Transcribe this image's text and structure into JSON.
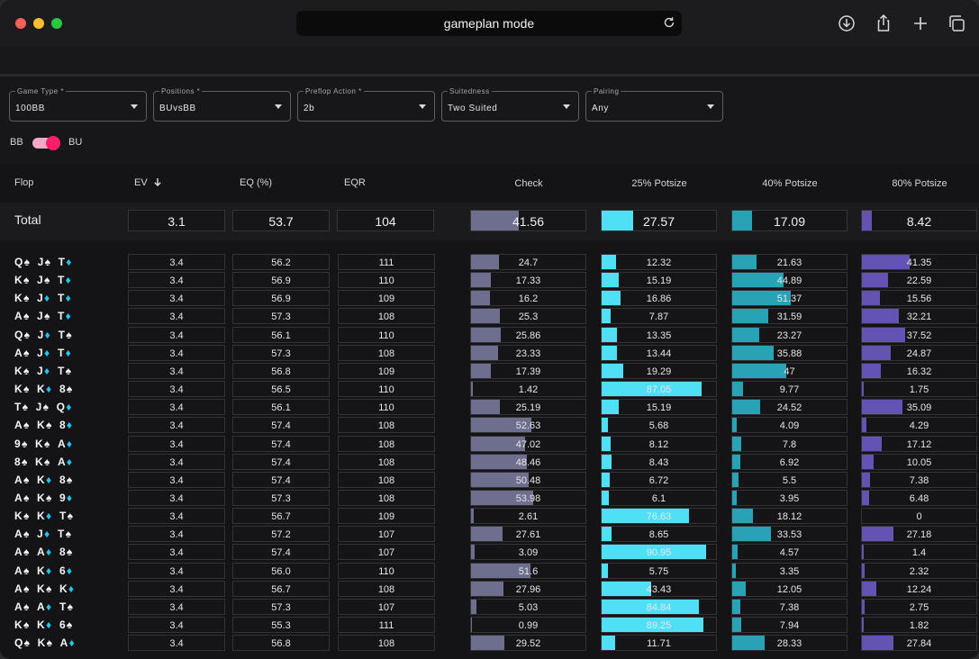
{
  "browser": {
    "address": "gameplan mode"
  },
  "filters": [
    {
      "label": "Game Type *",
      "value": "100BB"
    },
    {
      "label": "Positions *",
      "value": "BUvsBB"
    },
    {
      "label": "Preflop Action *",
      "value": "2b"
    },
    {
      "label": "Suitedness",
      "value": "Two Suited"
    },
    {
      "label": "Pairing",
      "value": "Any"
    }
  ],
  "toggle": {
    "left": "BB",
    "right": "BU",
    "state": "BU"
  },
  "headers": {
    "flop": "Flop",
    "ev": "EV",
    "eq": "EQ (%)",
    "eqr": "EQR",
    "check": "Check",
    "bet25": "25% Potsize",
    "bet40": "40% Potsize",
    "bet80": "80% Potsize"
  },
  "colors": {
    "check": "#6e6e8e",
    "bet25": "#50e0f5",
    "bet40": "#2aa2b6",
    "bet80": "#6553b4",
    "toggle": "#ff1d6c",
    "spade": "#f4f4f6",
    "diamond": "#21c6f2"
  },
  "total": {
    "label": "Total",
    "ev": "3.1",
    "eq": "53.7",
    "eqr": "104",
    "check": "41.56",
    "bet25": "27.57",
    "bet40": "17.09",
    "bet80": "8.42"
  },
  "rows": [
    {
      "cards": [
        [
          "Q",
          "s"
        ],
        [
          "J",
          "s"
        ],
        [
          "T",
          "d"
        ]
      ],
      "ev": "3.4",
      "eq": "56.2",
      "eqr": "111",
      "check": "24.7",
      "bet25": "12.32",
      "bet40": "21.63",
      "bet80": "41.35"
    },
    {
      "cards": [
        [
          "K",
          "s"
        ],
        [
          "J",
          "s"
        ],
        [
          "T",
          "d"
        ]
      ],
      "ev": "3.4",
      "eq": "56.9",
      "eqr": "110",
      "check": "17.33",
      "bet25": "15.19",
      "bet40": "44.89",
      "bet80": "22.59"
    },
    {
      "cards": [
        [
          "K",
          "s"
        ],
        [
          "J",
          "d"
        ],
        [
          "T",
          "d"
        ]
      ],
      "ev": "3.4",
      "eq": "56.9",
      "eqr": "109",
      "check": "16.2",
      "bet25": "16.86",
      "bet40": "51.37",
      "bet80": "15.56"
    },
    {
      "cards": [
        [
          "A",
          "s"
        ],
        [
          "J",
          "s"
        ],
        [
          "T",
          "d"
        ]
      ],
      "ev": "3.4",
      "eq": "57.3",
      "eqr": "108",
      "check": "25.3",
      "bet25": "7.87",
      "bet40": "31.59",
      "bet80": "32.21"
    },
    {
      "cards": [
        [
          "Q",
          "s"
        ],
        [
          "J",
          "d"
        ],
        [
          "T",
          "s"
        ]
      ],
      "ev": "3.4",
      "eq": "56.1",
      "eqr": "110",
      "check": "25.86",
      "bet25": "13.35",
      "bet40": "23.27",
      "bet80": "37.52"
    },
    {
      "cards": [
        [
          "A",
          "s"
        ],
        [
          "J",
          "d"
        ],
        [
          "T",
          "d"
        ]
      ],
      "ev": "3.4",
      "eq": "57.3",
      "eqr": "108",
      "check": "23.33",
      "bet25": "13.44",
      "bet40": "35.88",
      "bet80": "24.87"
    },
    {
      "cards": [
        [
          "K",
          "s"
        ],
        [
          "J",
          "d"
        ],
        [
          "T",
          "s"
        ]
      ],
      "ev": "3.4",
      "eq": "56.8",
      "eqr": "109",
      "check": "17.39",
      "bet25": "19.29",
      "bet40": "47",
      "bet80": "16.32"
    },
    {
      "cards": [
        [
          "K",
          "s"
        ],
        [
          "K",
          "d"
        ],
        [
          "8",
          "s"
        ]
      ],
      "ev": "3.4",
      "eq": "56.5",
      "eqr": "110",
      "check": "1.42",
      "bet25": "87.05",
      "bet40": "9.77",
      "bet80": "1.75"
    },
    {
      "cards": [
        [
          "T",
          "s"
        ],
        [
          "J",
          "s"
        ],
        [
          "Q",
          "d"
        ]
      ],
      "ev": "3.4",
      "eq": "56.1",
      "eqr": "110",
      "check": "25.19",
      "bet25": "15.19",
      "bet40": "24.52",
      "bet80": "35.09"
    },
    {
      "cards": [
        [
          "A",
          "s"
        ],
        [
          "K",
          "s"
        ],
        [
          "8",
          "d"
        ]
      ],
      "ev": "3.4",
      "eq": "57.4",
      "eqr": "108",
      "check": "52.63",
      "bet25": "5.68",
      "bet40": "4.09",
      "bet80": "4.29"
    },
    {
      "cards": [
        [
          "9",
          "s"
        ],
        [
          "K",
          "s"
        ],
        [
          "A",
          "d"
        ]
      ],
      "ev": "3.4",
      "eq": "57.4",
      "eqr": "108",
      "check": "47.02",
      "bet25": "8.12",
      "bet40": "7.8",
      "bet80": "17.12"
    },
    {
      "cards": [
        [
          "8",
          "s"
        ],
        [
          "K",
          "s"
        ],
        [
          "A",
          "d"
        ]
      ],
      "ev": "3.4",
      "eq": "57.4",
      "eqr": "108",
      "check": "48.46",
      "bet25": "8.43",
      "bet40": "6.92",
      "bet80": "10.05"
    },
    {
      "cards": [
        [
          "A",
          "s"
        ],
        [
          "K",
          "d"
        ],
        [
          "8",
          "s"
        ]
      ],
      "ev": "3.4",
      "eq": "57.4",
      "eqr": "108",
      "check": "50.48",
      "bet25": "6.72",
      "bet40": "5.5",
      "bet80": "7.38"
    },
    {
      "cards": [
        [
          "A",
          "s"
        ],
        [
          "K",
          "s"
        ],
        [
          "9",
          "d"
        ]
      ],
      "ev": "3.4",
      "eq": "57.3",
      "eqr": "108",
      "check": "53.98",
      "bet25": "6.1",
      "bet40": "3.95",
      "bet80": "6.48"
    },
    {
      "cards": [
        [
          "K",
          "s"
        ],
        [
          "K",
          "d"
        ],
        [
          "T",
          "s"
        ]
      ],
      "ev": "3.4",
      "eq": "56.7",
      "eqr": "109",
      "check": "2.61",
      "bet25": "76.63",
      "bet40": "18.12",
      "bet80": "0"
    },
    {
      "cards": [
        [
          "A",
          "s"
        ],
        [
          "J",
          "d"
        ],
        [
          "T",
          "s"
        ]
      ],
      "ev": "3.4",
      "eq": "57.2",
      "eqr": "107",
      "check": "27.61",
      "bet25": "8.65",
      "bet40": "33.53",
      "bet80": "27.18"
    },
    {
      "cards": [
        [
          "A",
          "s"
        ],
        [
          "A",
          "d"
        ],
        [
          "8",
          "s"
        ]
      ],
      "ev": "3.4",
      "eq": "57.4",
      "eqr": "107",
      "check": "3.09",
      "bet25": "90.95",
      "bet40": "4.57",
      "bet80": "1.4"
    },
    {
      "cards": [
        [
          "A",
          "s"
        ],
        [
          "K",
          "d"
        ],
        [
          "6",
          "d"
        ]
      ],
      "ev": "3.4",
      "eq": "56.0",
      "eqr": "110",
      "check": "51.6",
      "bet25": "5.75",
      "bet40": "3.35",
      "bet80": "2.32"
    },
    {
      "cards": [
        [
          "A",
          "s"
        ],
        [
          "K",
          "s"
        ],
        [
          "K",
          "d"
        ]
      ],
      "ev": "3.4",
      "eq": "56.7",
      "eqr": "108",
      "check": "27.96",
      "bet25": "43.43",
      "bet40": "12.05",
      "bet80": "12.24"
    },
    {
      "cards": [
        [
          "A",
          "s"
        ],
        [
          "A",
          "d"
        ],
        [
          "T",
          "s"
        ]
      ],
      "ev": "3.4",
      "eq": "57.3",
      "eqr": "107",
      "check": "5.03",
      "bet25": "84.84",
      "bet40": "7.38",
      "bet80": "2.75"
    },
    {
      "cards": [
        [
          "K",
          "s"
        ],
        [
          "K",
          "d"
        ],
        [
          "6",
          "s"
        ]
      ],
      "ev": "3.4",
      "eq": "55.3",
      "eqr": "111",
      "check": "0.99",
      "bet25": "89.25",
      "bet40": "7.94",
      "bet80": "1.82"
    },
    {
      "cards": [
        [
          "Q",
          "s"
        ],
        [
          "K",
          "s"
        ],
        [
          "A",
          "d"
        ]
      ],
      "ev": "3.4",
      "eq": "56.8",
      "eqr": "108",
      "check": "29.52",
      "bet25": "11.71",
      "bet40": "28.33",
      "bet80": "27.84"
    }
  ]
}
